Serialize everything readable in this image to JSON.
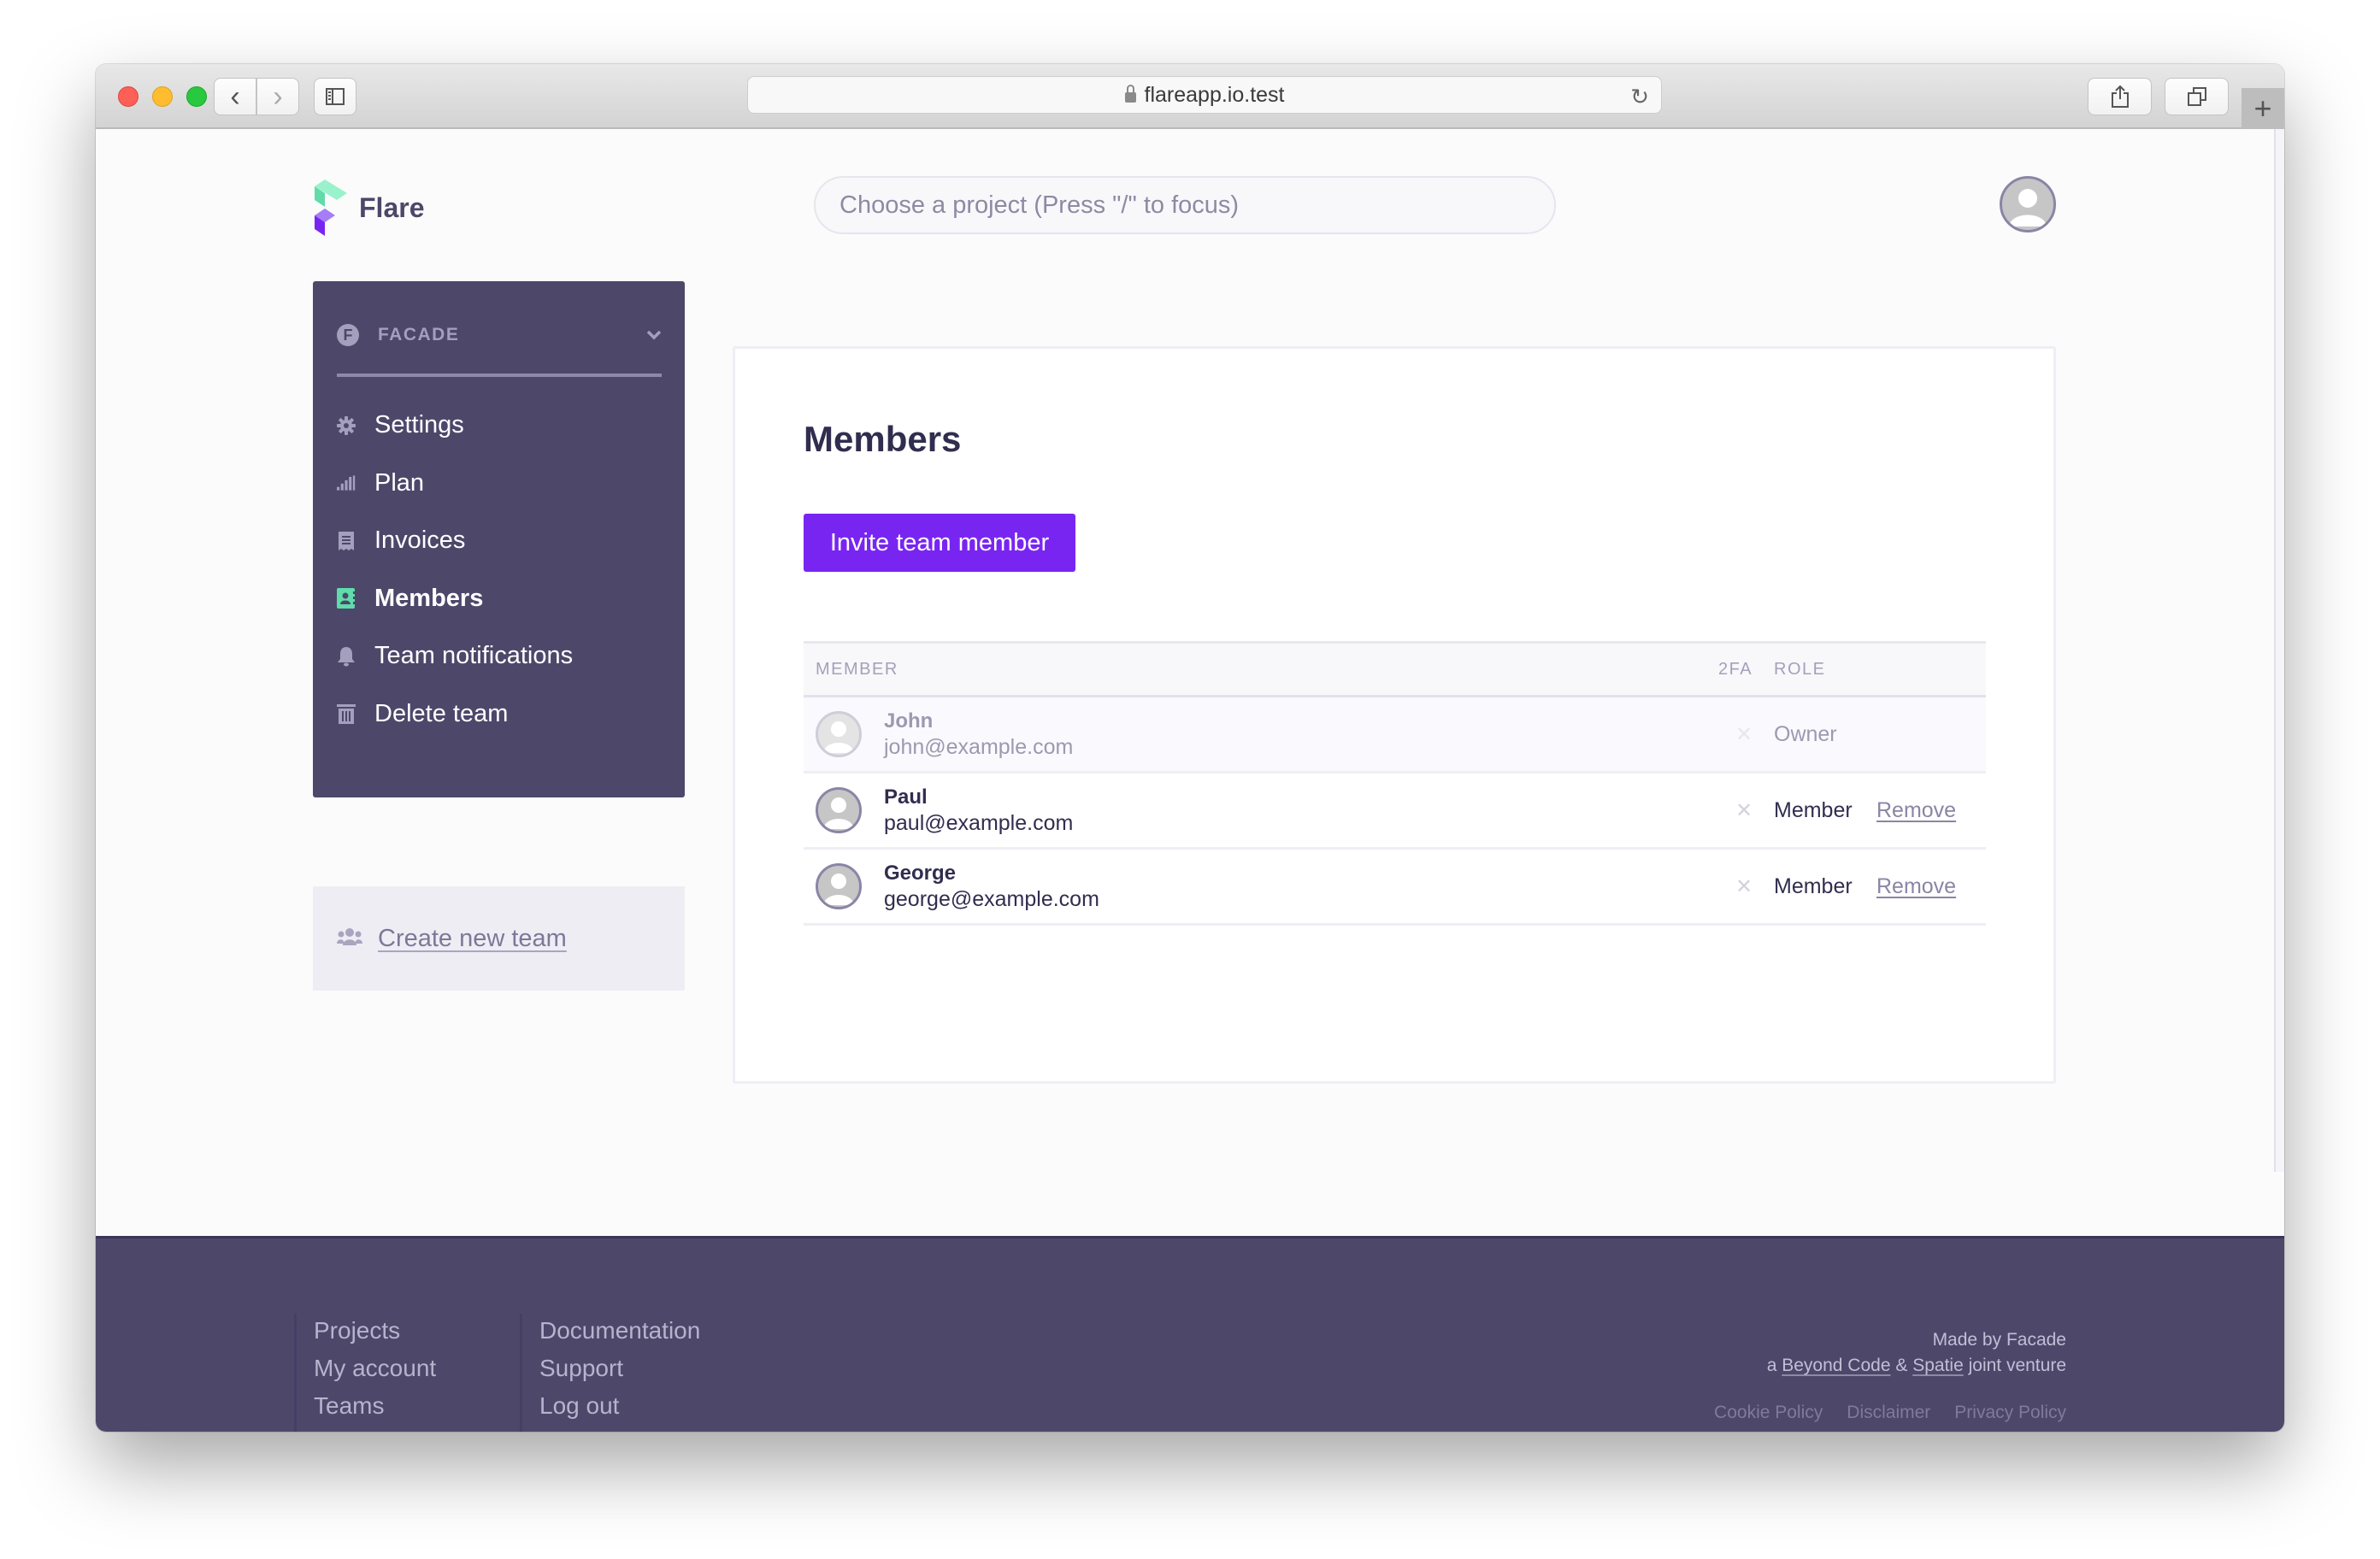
{
  "browser": {
    "url": "flareapp.io.test",
    "back_label": "‹",
    "forward_label": "›",
    "reload_label": "↻",
    "new_tab_label": "+"
  },
  "header": {
    "brand": "Flare",
    "search_placeholder": "Choose a project (Press \"/\" to focus)"
  },
  "sidebar": {
    "team": {
      "badge": "F",
      "name": "FACADE"
    },
    "items": [
      {
        "label": "Settings",
        "icon": "gear-icon",
        "active": false
      },
      {
        "label": "Plan",
        "icon": "signal-bars-icon",
        "active": false
      },
      {
        "label": "Invoices",
        "icon": "receipt-icon",
        "active": false
      },
      {
        "label": "Members",
        "icon": "contact-card-icon",
        "active": true
      },
      {
        "label": "Team notifications",
        "icon": "bell-icon",
        "active": false
      },
      {
        "label": "Delete team",
        "icon": "trash-icon",
        "active": false
      }
    ],
    "create_team_label": "Create new team"
  },
  "main": {
    "title": "Members",
    "invite_button": "Invite team member",
    "table": {
      "headers": {
        "member": "MEMBER",
        "twofa": "2FA",
        "role": "ROLE"
      },
      "rows": [
        {
          "name": "John",
          "email": "john@example.com",
          "twofa": "✕",
          "role": "Owner",
          "action": ""
        },
        {
          "name": "Paul",
          "email": "paul@example.com",
          "twofa": "✕",
          "role": "Member",
          "action": "Remove"
        },
        {
          "name": "George",
          "email": "george@example.com",
          "twofa": "✕",
          "role": "Member",
          "action": "Remove"
        }
      ]
    }
  },
  "footer": {
    "col1": [
      "Projects",
      "My account",
      "Teams"
    ],
    "col2": [
      "Documentation",
      "Support",
      "Log out"
    ],
    "made_by": "Made by Facade",
    "venture_prefix": "a",
    "venture_link1": "Beyond Code",
    "venture_amp": "&",
    "venture_link2": "Spatie",
    "venture_suffix": "joint venture",
    "legal": [
      "Cookie Policy",
      "Disclaimer",
      "Privacy Policy"
    ]
  },
  "colors": {
    "brand_dark": "#4d476a",
    "accent_purple": "#7925f1",
    "active_icon_green": "#5fdcaa",
    "heading": "#312d4f"
  }
}
